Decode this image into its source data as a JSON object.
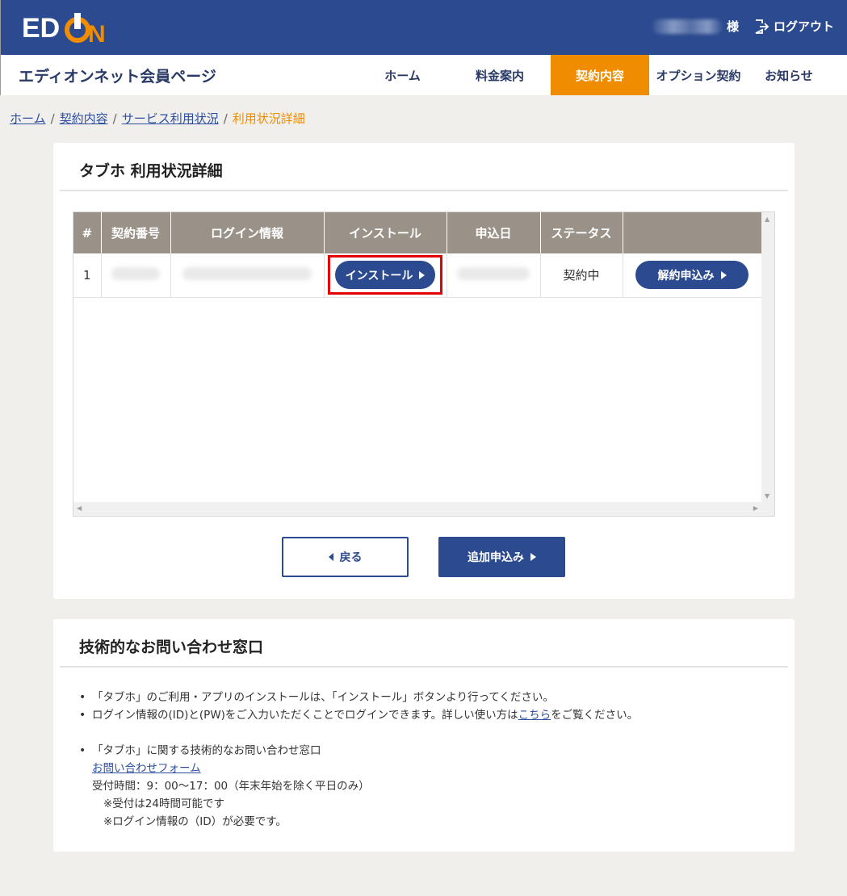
{
  "header": {
    "logo_text": "EDION",
    "user_suffix": "様",
    "logout_label": "ログアウト",
    "colors": {
      "brand": "#2b4a8f",
      "accent": "#ef8c00"
    }
  },
  "nav": {
    "site_title": "エディオンネット会員ページ",
    "tabs": [
      {
        "label": "ホーム"
      },
      {
        "label": "料金案内"
      },
      {
        "label": "契約内容",
        "active": true
      },
      {
        "label": "オプション契約"
      },
      {
        "label": "お知らせ"
      }
    ]
  },
  "breadcrumb": {
    "items": [
      "ホーム",
      "契約内容",
      "サービス利用状況"
    ],
    "current": "利用状況詳細",
    "separator": "/"
  },
  "detail_card": {
    "title": "タブホ 利用状況詳細",
    "table": {
      "headers": [
        "#",
        "契約番号",
        "ログイン情報",
        "インストール",
        "申込日",
        "ステータス",
        ""
      ],
      "rows": [
        {
          "index": "1",
          "install_button": "インストール",
          "status": "契約中",
          "cancel_button": "解約申込み"
        }
      ]
    },
    "back_button": "戻る",
    "add_button": "追加申込み"
  },
  "support_card": {
    "title": "技術的なお問い合わせ窓口",
    "bullet1": "「タブホ」のご利用・アプリのインストールは、「インストール」ボタンより行ってください。",
    "bullet2_pre": "ログイン情報の(ID)と(PW)をご入力いただくことでログインできます。詳しい使い方は",
    "bullet2_link": "こちら",
    "bullet2_post": "をご覧ください。",
    "bullet3": "「タブホ」に関する技術的なお問い合わせ窓口",
    "contact_link": "お問い合わせフォーム",
    "hours": "受付時間：9：00～17：00（年末年始を除く平日のみ）",
    "note1": "※受付は24時間可能です",
    "note2": "※ログイン情報の（ID）が必要です。"
  }
}
